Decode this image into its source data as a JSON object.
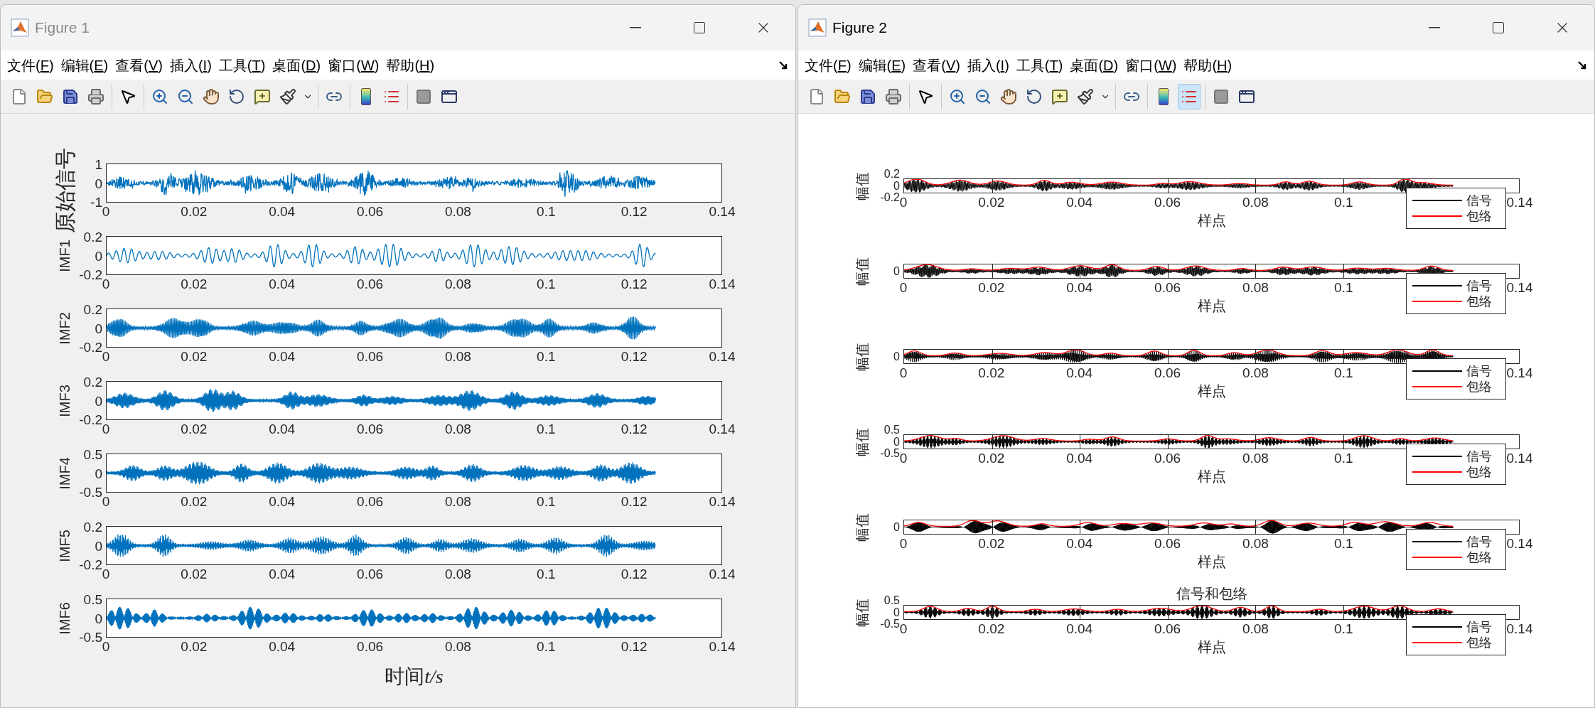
{
  "windows": [
    {
      "title": "Figure 1",
      "active": false,
      "kind": "imf",
      "menu": [
        "文件(F)",
        "编辑(E)",
        "查看(V)",
        "插入(I)",
        "工具(T)",
        "桌面(D)",
        "窗口(W)",
        "帮助(H)"
      ],
      "toolbar": [
        [
          {
            "kind": "new",
            "selected": false
          },
          {
            "kind": "open",
            "selected": false
          },
          {
            "kind": "save",
            "selected": false
          },
          {
            "kind": "print",
            "selected": false
          }
        ],
        [
          {
            "kind": "pointer",
            "selected": false
          }
        ],
        [
          {
            "kind": "zoom-in",
            "selected": false
          },
          {
            "kind": "zoom-out",
            "selected": false
          },
          {
            "kind": "pan",
            "selected": false
          },
          {
            "kind": "rotate",
            "selected": false
          },
          {
            "kind": "data-cursor",
            "selected": false
          },
          {
            "kind": "brush",
            "selected": false
          },
          {
            "kind": "caret",
            "selected": false
          }
        ],
        [
          {
            "kind": "link",
            "selected": false
          }
        ],
        [
          {
            "kind": "colorbar",
            "selected": false
          },
          {
            "kind": "legend",
            "selected": false
          }
        ],
        [
          {
            "kind": "hide",
            "selected": false
          },
          {
            "kind": "property",
            "selected": false
          }
        ]
      ],
      "plots": [
        {
          "ylabel": "原始信号",
          "kind": "serif",
          "yticks": [
            "1",
            "0",
            "-1"
          ],
          "xticks": [
            "0",
            "0.02",
            "0.04",
            "0.06",
            "0.08",
            "0.1",
            "0.12",
            "0.14"
          ]
        },
        {
          "ylabel": "IMF1",
          "yticks": [
            "0.2",
            "0",
            "-0.2"
          ],
          "xticks": [
            "0",
            "0.02",
            "0.04",
            "0.06",
            "0.08",
            "0.1",
            "0.12",
            "0.14"
          ]
        },
        {
          "ylabel": "IMF2",
          "yticks": [
            "0.2",
            "0",
            "-0.2"
          ],
          "xticks": [
            "0",
            "0.02",
            "0.04",
            "0.06",
            "0.08",
            "0.1",
            "0.12",
            "0.14"
          ]
        },
        {
          "ylabel": "IMF3",
          "yticks": [
            "0.2",
            "0",
            "-0.2"
          ],
          "xticks": [
            "0",
            "0.02",
            "0.04",
            "0.06",
            "0.08",
            "0.1",
            "0.12",
            "0.14"
          ]
        },
        {
          "ylabel": "IMF4",
          "yticks": [
            "0.5",
            "0",
            "-0.5"
          ],
          "xticks": [
            "0",
            "0.02",
            "0.04",
            "0.06",
            "0.08",
            "0.1",
            "0.12",
            "0.14"
          ]
        },
        {
          "ylabel": "IMF5",
          "yticks": [
            "0.2",
            "0",
            "-0.2"
          ],
          "xticks": [
            "0",
            "0.02",
            "0.04",
            "0.06",
            "0.08",
            "0.1",
            "0.12",
            "0.14"
          ]
        },
        {
          "ylabel": "IMF6",
          "yticks": [
            "0.5",
            "0",
            "-0.5"
          ],
          "xticks": [
            "0",
            "0.02",
            "0.04",
            "0.06",
            "0.08",
            "0.1",
            "0.12",
            "0.14"
          ],
          "xlabel": "时间",
          "xlabel_unit": "t/s"
        }
      ]
    },
    {
      "title": "Figure 2",
      "active": true,
      "kind": "envelope",
      "menu": [
        "文件(F)",
        "编辑(E)",
        "查看(V)",
        "插入(I)",
        "工具(T)",
        "桌面(D)",
        "窗口(W)",
        "帮助(H)"
      ],
      "toolbar": [
        [
          {
            "kind": "new",
            "selected": false
          },
          {
            "kind": "open",
            "selected": false
          },
          {
            "kind": "save",
            "selected": false
          },
          {
            "kind": "print",
            "selected": false
          }
        ],
        [
          {
            "kind": "pointer",
            "selected": false
          }
        ],
        [
          {
            "kind": "zoom-in",
            "selected": false
          },
          {
            "kind": "zoom-out",
            "selected": false
          },
          {
            "kind": "pan",
            "selected": false
          },
          {
            "kind": "rotate",
            "selected": false
          },
          {
            "kind": "data-cursor",
            "selected": false
          },
          {
            "kind": "brush",
            "selected": false
          },
          {
            "kind": "caret",
            "selected": false
          }
        ],
        [
          {
            "kind": "link",
            "selected": false
          }
        ],
        [
          {
            "kind": "colorbar",
            "selected": false
          },
          {
            "kind": "legend",
            "selected": true
          }
        ],
        [
          {
            "kind": "hide",
            "selected": false
          },
          {
            "kind": "property",
            "selected": false
          }
        ]
      ],
      "plots": [
        {
          "ylabel": "幅值",
          "yticks": [
            "0.2",
            "0",
            "-0.2"
          ],
          "xticks": [
            "0",
            "0.02",
            "0.04",
            "0.06",
            "0.08",
            "0.1",
            "0.14"
          ],
          "xlabel": "样点",
          "legend": [
            {
              "label": "信号",
              "color": "#000000"
            },
            {
              "label": "包络",
              "color": "#ff0000"
            }
          ]
        },
        {
          "ylabel": "幅值",
          "yticks": [
            "0"
          ],
          "xticks": [
            "0",
            "0.02",
            "0.04",
            "0.06",
            "0.08",
            "0.1",
            "0.14"
          ],
          "xlabel": "样点",
          "legend": [
            {
              "label": "信号",
              "color": "#000000"
            },
            {
              "label": "包络",
              "color": "#ff0000"
            }
          ]
        },
        {
          "ylabel": "幅值",
          "yticks": [
            "0"
          ],
          "xticks": [
            "0",
            "0.02",
            "0.04",
            "0.06",
            "0.08",
            "0.1",
            "0.14"
          ],
          "xlabel": "样点",
          "legend": [
            {
              "label": "信号",
              "color": "#000000"
            },
            {
              "label": "包络",
              "color": "#ff0000"
            }
          ]
        },
        {
          "ylabel": "幅值",
          "yticks": [
            "0.5",
            "0",
            "-0.5"
          ],
          "xticks": [
            "0",
            "0.02",
            "0.04",
            "0.06",
            "0.08",
            "0.1",
            "0.14"
          ],
          "xlabel": "样点",
          "legend": [
            {
              "label": "信号",
              "color": "#000000"
            },
            {
              "label": "包络",
              "color": "#ff0000"
            }
          ]
        },
        {
          "ylabel": "幅值",
          "yticks": [
            "0"
          ],
          "xticks": [
            "0",
            "0.02",
            "0.04",
            "0.06",
            "0.08",
            "0.1",
            "0.14"
          ],
          "xlabel": "样点",
          "legend": [
            {
              "label": "信号",
              "color": "#000000"
            },
            {
              "label": "包络",
              "color": "#ff0000"
            }
          ]
        },
        {
          "title": "信号和包络",
          "ylabel": "幅值",
          "yticks": [
            "0.5",
            "0",
            "-0.5"
          ],
          "xticks": [
            "0",
            "0.02",
            "0.04",
            "0.06",
            "0.08",
            "0.1",
            "0.14"
          ],
          "xlabel": "样点",
          "legend": [
            {
              "label": "信号",
              "color": "#000000"
            },
            {
              "label": "包络",
              "color": "#ff0000"
            }
          ]
        }
      ]
    }
  ]
}
